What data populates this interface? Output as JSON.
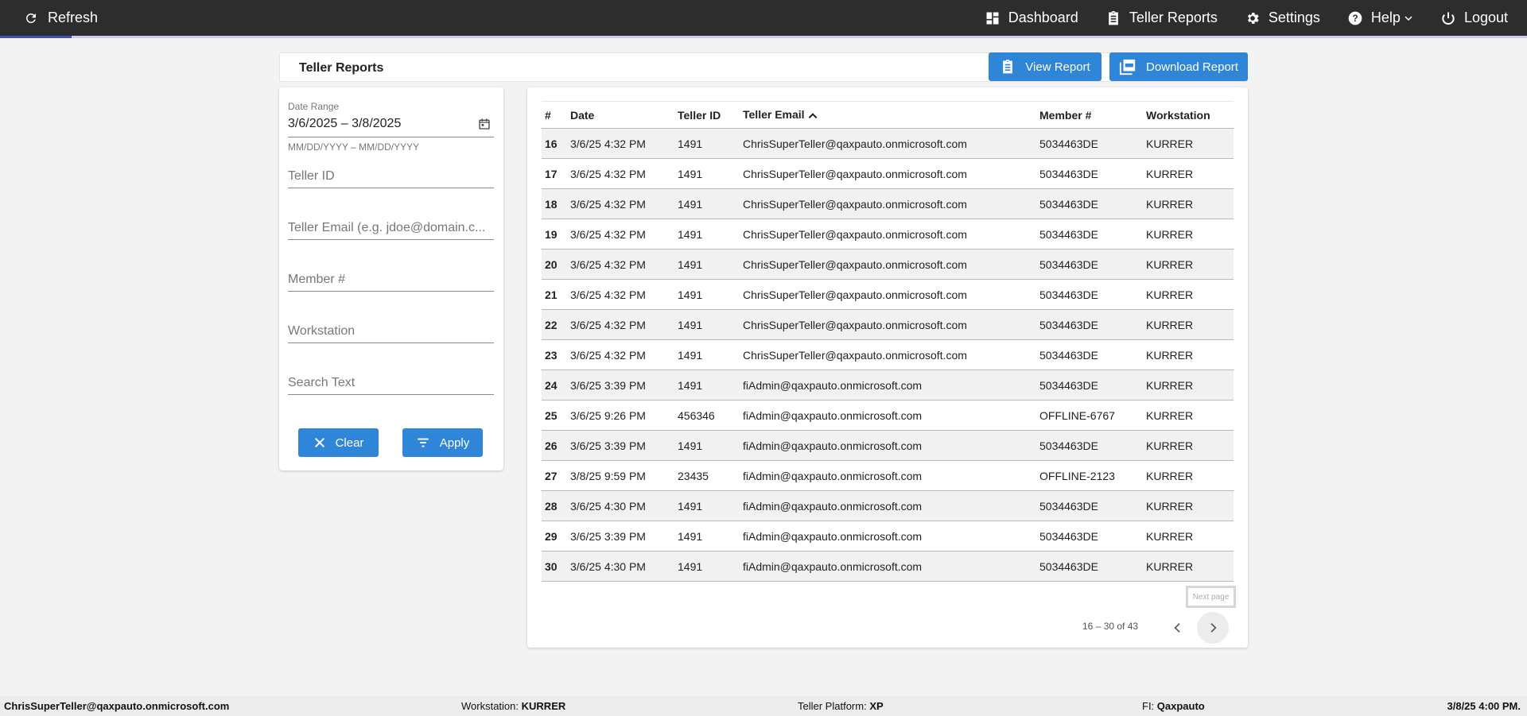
{
  "topbar": {
    "refresh_label": "Refresh",
    "nav": [
      {
        "label": "Dashboard",
        "icon": "dashboard-icon"
      },
      {
        "label": "Teller Reports",
        "icon": "clipboard-icon"
      },
      {
        "label": "Settings",
        "icon": "gear-icon"
      },
      {
        "label": "Help",
        "icon": "help-icon"
      },
      {
        "label": "Logout",
        "icon": "power-icon"
      }
    ],
    "progress_fraction": 0.047
  },
  "header": {
    "title": "Teller Reports",
    "view_report_label": "View Report",
    "download_report_label": "Download Report"
  },
  "filters": {
    "date_range_label": "Date Range",
    "date_range_value": "3/6/2025 – 3/8/2025",
    "date_range_hint": "MM/DD/YYYY – MM/DD/YYYY",
    "teller_id_placeholder": "Teller ID",
    "teller_email_placeholder": "Teller Email (e.g. jdoe@domain.c...",
    "member_placeholder": "Member #",
    "workstation_placeholder": "Workstation",
    "search_placeholder": "Search Text",
    "clear_label": "Clear",
    "apply_label": "Apply"
  },
  "table": {
    "headers": {
      "num": "#",
      "date": "Date",
      "teller_id": "Teller ID",
      "teller_email": "Teller Email",
      "member": "Member #",
      "workstation": "Workstation"
    },
    "rows": [
      {
        "num": "16",
        "date": "3/6/25 4:32 PM",
        "teller_id": "1491",
        "email": "ChrisSuperTeller@qaxpauto.onmicrosoft.com",
        "member": "5034463DE",
        "workstation": "KURRER"
      },
      {
        "num": "17",
        "date": "3/6/25 4:32 PM",
        "teller_id": "1491",
        "email": "ChrisSuperTeller@qaxpauto.onmicrosoft.com",
        "member": "5034463DE",
        "workstation": "KURRER"
      },
      {
        "num": "18",
        "date": "3/6/25 4:32 PM",
        "teller_id": "1491",
        "email": "ChrisSuperTeller@qaxpauto.onmicrosoft.com",
        "member": "5034463DE",
        "workstation": "KURRER"
      },
      {
        "num": "19",
        "date": "3/6/25 4:32 PM",
        "teller_id": "1491",
        "email": "ChrisSuperTeller@qaxpauto.onmicrosoft.com",
        "member": "5034463DE",
        "workstation": "KURRER"
      },
      {
        "num": "20",
        "date": "3/6/25 4:32 PM",
        "teller_id": "1491",
        "email": "ChrisSuperTeller@qaxpauto.onmicrosoft.com",
        "member": "5034463DE",
        "workstation": "KURRER"
      },
      {
        "num": "21",
        "date": "3/6/25 4:32 PM",
        "teller_id": "1491",
        "email": "ChrisSuperTeller@qaxpauto.onmicrosoft.com",
        "member": "5034463DE",
        "workstation": "KURRER"
      },
      {
        "num": "22",
        "date": "3/6/25 4:32 PM",
        "teller_id": "1491",
        "email": "ChrisSuperTeller@qaxpauto.onmicrosoft.com",
        "member": "5034463DE",
        "workstation": "KURRER"
      },
      {
        "num": "23",
        "date": "3/6/25 4:32 PM",
        "teller_id": "1491",
        "email": "ChrisSuperTeller@qaxpauto.onmicrosoft.com",
        "member": "5034463DE",
        "workstation": "KURRER"
      },
      {
        "num": "24",
        "date": "3/6/25 3:39 PM",
        "teller_id": "1491",
        "email": "fiAdmin@qaxpauto.onmicrosoft.com",
        "member": "5034463DE",
        "workstation": "KURRER"
      },
      {
        "num": "25",
        "date": "3/6/25 9:26 PM",
        "teller_id": "456346",
        "email": "fiAdmin@qaxpauto.onmicrosoft.com",
        "member": "OFFLINE-6767",
        "workstation": "KURRER"
      },
      {
        "num": "26",
        "date": "3/6/25 3:39 PM",
        "teller_id": "1491",
        "email": "fiAdmin@qaxpauto.onmicrosoft.com",
        "member": "5034463DE",
        "workstation": "KURRER"
      },
      {
        "num": "27",
        "date": "3/8/25 9:59 PM",
        "teller_id": "23435",
        "email": "fiAdmin@qaxpauto.onmicrosoft.com",
        "member": "OFFLINE-2123",
        "workstation": "KURRER"
      },
      {
        "num": "28",
        "date": "3/6/25 4:30 PM",
        "teller_id": "1491",
        "email": "fiAdmin@qaxpauto.onmicrosoft.com",
        "member": "5034463DE",
        "workstation": "KURRER"
      },
      {
        "num": "29",
        "date": "3/6/25 3:39 PM",
        "teller_id": "1491",
        "email": "fiAdmin@qaxpauto.onmicrosoft.com",
        "member": "5034463DE",
        "workstation": "KURRER"
      },
      {
        "num": "30",
        "date": "3/6/25 4:30 PM",
        "teller_id": "1491",
        "email": "fiAdmin@qaxpauto.onmicrosoft.com",
        "member": "5034463DE",
        "workstation": "KURRER"
      }
    ]
  },
  "pagination": {
    "tooltip": "Next page",
    "range_text": "16 – 30 of 43"
  },
  "footer": {
    "user_email": "ChrisSuperTeller@qaxpauto.onmicrosoft.com",
    "workstation_label": "Workstation:",
    "workstation_value": "KURRER",
    "platform_label": "Teller Platform:",
    "platform_value": "XP",
    "fi_label": "FI:",
    "fi_value": "Qaxpauto",
    "datetime": "3/8/25 4:00 PM."
  },
  "colors": {
    "topbar": "#2d2d2d",
    "accent": "#2f86d8",
    "progress": "#3f51b5"
  }
}
